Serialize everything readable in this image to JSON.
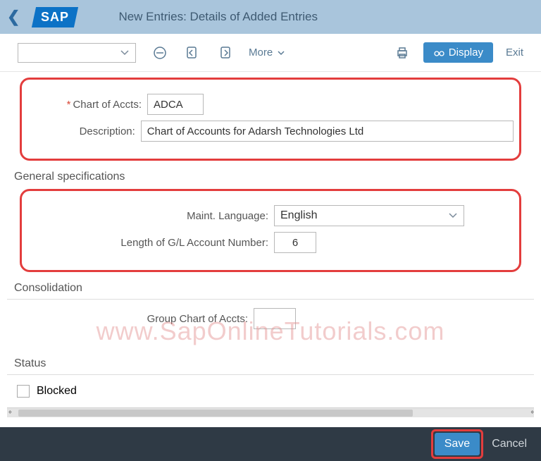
{
  "header": {
    "title": "New Entries: Details of Added Entries",
    "logo": "SAP"
  },
  "toolbar": {
    "more_label": "More",
    "display_label": "Display",
    "exit_label": "Exit"
  },
  "form": {
    "chart_of_accts": {
      "label": "Chart of Accts:",
      "value": "ADCA"
    },
    "description": {
      "label": "Description:",
      "value": "Chart of Accounts for Adarsh Technologies Ltd"
    }
  },
  "sections": {
    "general": {
      "title": "General specifications",
      "maint_language": {
        "label": "Maint. Language:",
        "value": "English"
      },
      "gl_length": {
        "label": "Length of G/L Account Number:",
        "value": "6"
      }
    },
    "consolidation": {
      "title": "Consolidation",
      "group_chart": {
        "label": "Group Chart of Accts:",
        "value": ""
      }
    },
    "status": {
      "title": "Status",
      "blocked_label": "Blocked"
    }
  },
  "footer": {
    "save_label": "Save",
    "cancel_label": "Cancel"
  },
  "watermark": "www.SapOnlineTutorials.com"
}
